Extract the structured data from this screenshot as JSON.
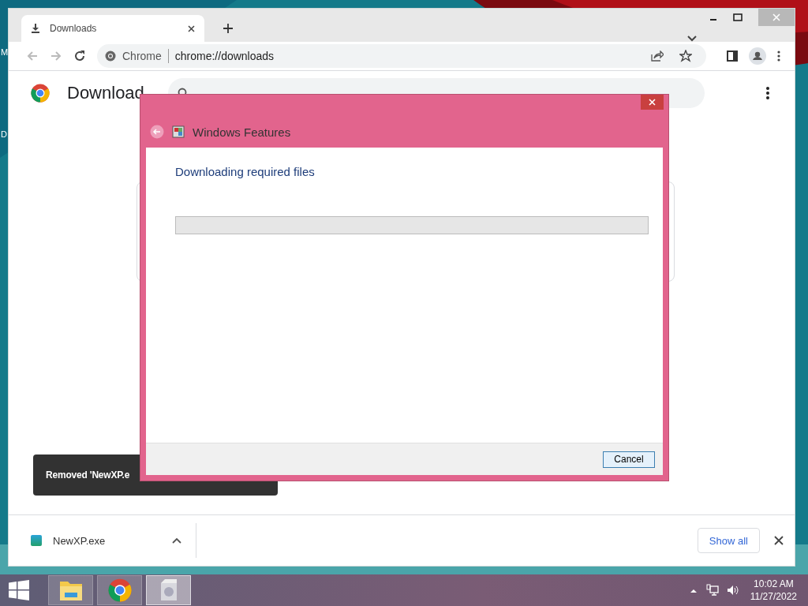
{
  "desktop_icon_labels": [
    "M",
    "D"
  ],
  "browser": {
    "tab": {
      "title": "Downloads",
      "selected": true
    },
    "address": {
      "site_label": "Chrome",
      "url": "chrome://downloads"
    },
    "page": {
      "title": "Download",
      "toast": "Removed 'NewXP.e"
    },
    "shelf": {
      "item": "NewXP.exe",
      "button": "Show all"
    }
  },
  "dialog": {
    "title": "Windows Features",
    "heading": "Downloading required files",
    "progress": {
      "level": 0
    },
    "button": "Cancel"
  },
  "taskbar": {
    "apps": [
      {
        "kind": "explorer",
        "selected": false
      },
      {
        "kind": "chrome",
        "selected": false
      },
      {
        "kind": "features",
        "selected": true
      }
    ],
    "time": "10:02 AM",
    "date": "11/27/2022"
  }
}
